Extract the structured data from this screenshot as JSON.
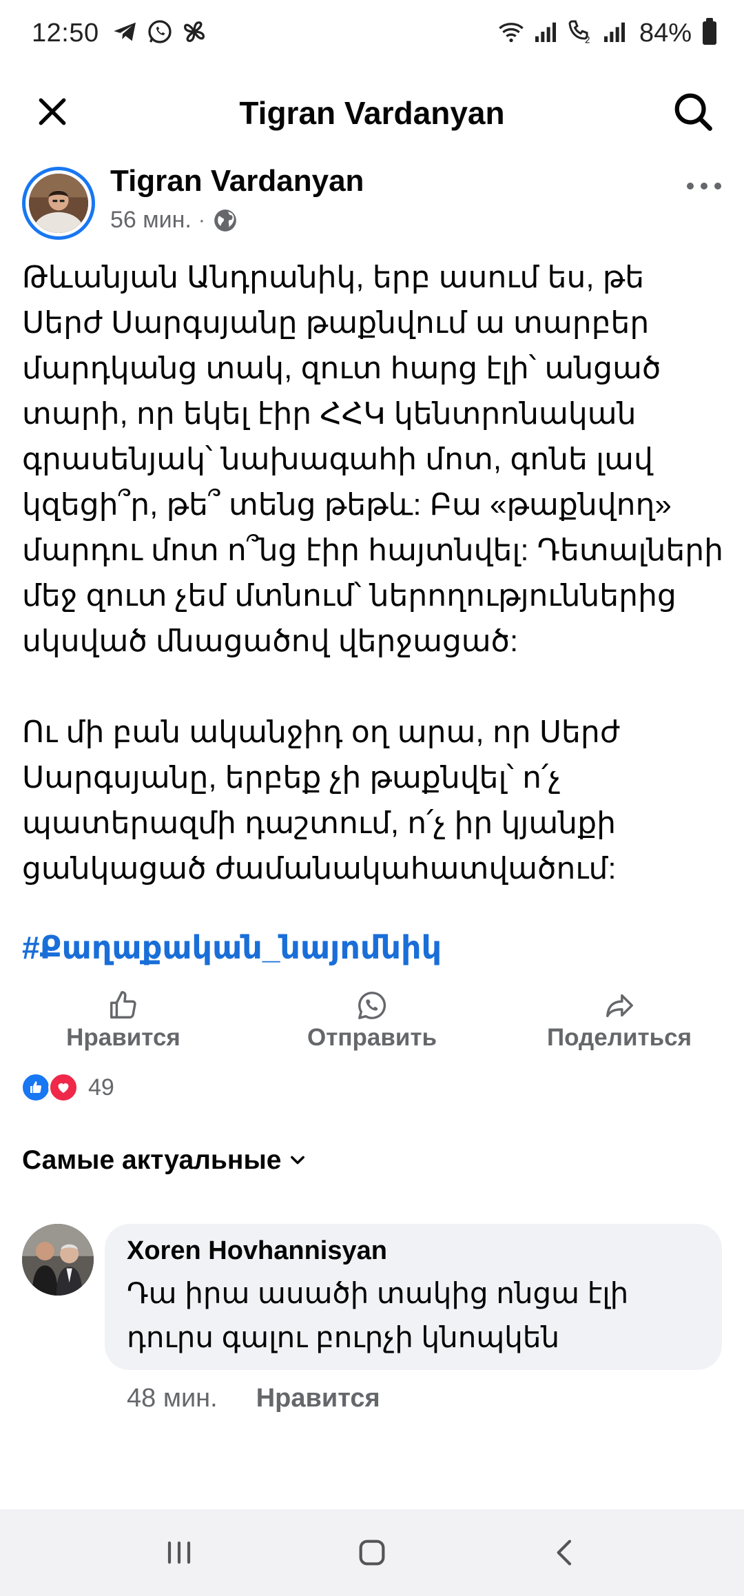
{
  "status_bar": {
    "time": "12:50",
    "battery_percent": "84%",
    "left_icons": [
      "telegram-icon",
      "whatsapp-icon",
      "pinwheel-icon"
    ],
    "right_icons": [
      "wifi-icon",
      "signal-icon",
      "wifi-calling-icon",
      "signal-icon"
    ]
  },
  "app_bar": {
    "title": "Tigran Vardanyan",
    "close_icon": "close-icon",
    "search_icon": "search-icon"
  },
  "post": {
    "author": "Tigran Vardanyan",
    "time": "56 мин.",
    "separator": "·",
    "audience_icon": "globe-icon",
    "paragraphs": [
      "Թևանյան Անդրանիկ, երբ ասում ես, թե Սերժ Սարգսյանը թաքնվում ա տարբեր մարդկանց տակ, զուտ հարց էլի՝ անցած տարի, որ եկել էիր ՀՀԿ կենտրոնական գրասենյակ՝ նախագահի մոտ, գոնե լավ կզեցի՞ր, թե՞ տենց թեթև: Բա «թաքնվող» մարդու մոտ ո՞նց էիր հայտնվել: Դետալների մեջ զուտ չեմ մտնում՝ ներողություններից սկսված մնացածով վերջացած:",
      "Ու մի բան ականջիդ օղ արա, որ Սերժ Սարգսյանը, երբեք չի թաքնվել՝ ո՛չ պատերազմի դաշտում, ո՛չ իր կյանքի ցանկացած ժամանակահատվածում:"
    ],
    "hashtag": "#Քաղաքական_նայոմնիկ"
  },
  "actions": {
    "like_label": "Нравится",
    "send_label": "Отправить",
    "share_label": "Поделиться"
  },
  "reactions": {
    "count": "49",
    "types": [
      "like",
      "love"
    ]
  },
  "comments_sort": {
    "label": "Самые актуальные"
  },
  "comment": {
    "author": "Xoren Hovhannisyan",
    "text": "Դա իրա ասածի տակից ոնցա էլի դուրս գալու բուրչի կնոպկեն",
    "time": "48 мин.",
    "like_label": "Нравится"
  },
  "colors": {
    "accent": "#1877f2",
    "hashtag": "#1a6ed8",
    "secondary_text": "#65676b",
    "bubble": "#f0f2f5",
    "love": "#f02849"
  }
}
